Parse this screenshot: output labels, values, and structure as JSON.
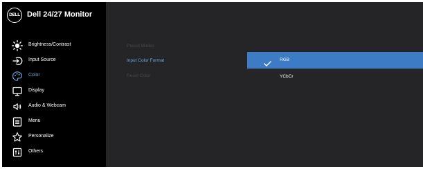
{
  "header": {
    "logo_text": "DɆLL",
    "title": "Dell 24/27 Monitor"
  },
  "menu": {
    "items": [
      {
        "label": "Brightness/Contrast",
        "icon": "brightness-icon"
      },
      {
        "label": "Input Source",
        "icon": "input-source-icon"
      },
      {
        "label": "Color",
        "icon": "color-palette-icon",
        "active": true
      },
      {
        "label": "Display",
        "icon": "display-icon"
      },
      {
        "label": "Audio & Webcam",
        "icon": "audio-speaker-icon"
      },
      {
        "label": "Menu",
        "icon": "menu-list-icon"
      },
      {
        "label": "Personalize",
        "icon": "star-icon"
      },
      {
        "label": "Others",
        "icon": "others-icon"
      }
    ]
  },
  "submenu": {
    "items": [
      {
        "label": "Preset Modes",
        "state": "disabled"
      },
      {
        "label": "Input Color Format",
        "state": "selected"
      },
      {
        "label": "Reset Color",
        "state": "disabled"
      }
    ]
  },
  "options": {
    "items": [
      {
        "label": "RGB",
        "checked": true,
        "highlighted": true
      },
      {
        "label": "YCbCr",
        "checked": false,
        "highlighted": false
      }
    ]
  },
  "colors": {
    "background": "#252527",
    "sidebar": "#000000",
    "accent": "#3d7bc4",
    "active_text": "#6ea6d8",
    "disabled_text": "#48484a"
  }
}
